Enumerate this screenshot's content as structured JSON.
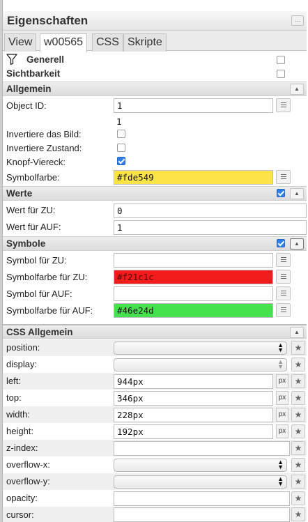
{
  "panel": {
    "title": "Eigenschaften",
    "menu_glyph": "…"
  },
  "tabs": [
    "View",
    "w00565",
    "CSS",
    "Skripte"
  ],
  "filter": {
    "generell": "Generell",
    "sichtbarkeit": "Sichtbarkeit"
  },
  "allgemein": {
    "title": "Allgemein",
    "object_id_label": "Object ID:",
    "object_id_value": "1",
    "object_id_text": "1",
    "invert_image_label": "Invertiere das Bild:",
    "invert_state_label": "Invertiere Zustand:",
    "button_square_label": "Knopf-Viereck:",
    "symbol_color_label": "Symbolfarbe:",
    "symbol_color_value": "#fde549"
  },
  "werte": {
    "title": "Werte",
    "zu_label": "Wert für ZU:",
    "zu_value": "0",
    "auf_label": "Wert für AUF:",
    "auf_value": "1"
  },
  "symbole": {
    "title": "Symbole",
    "symbol_zu_label": "Symbol für ZU:",
    "symbol_zu_value": "",
    "color_zu_label": "Symbolfarbe für ZU:",
    "color_zu_value": "#f21c1c",
    "symbol_auf_label": "Symbol für AUF:",
    "symbol_auf_value": "",
    "color_auf_label": "Symbolfarbe für AUF:",
    "color_auf_value": "#46e24d"
  },
  "css": {
    "title": "CSS Allgemein",
    "position_label": "position:",
    "display_label": "display:",
    "left_label": "left:",
    "left_value": "944px",
    "top_label": "top:",
    "top_value": "346px",
    "width_label": "width:",
    "width_value": "228px",
    "height_label": "height:",
    "height_value": "192px",
    "zindex_label": "z-index:",
    "overflowx_label": "overflow-x:",
    "overflowy_label": "overflow-y:",
    "opacity_label": "opacity:",
    "cursor_label": "cursor:",
    "px_unit": "px"
  },
  "colors": {
    "yellow": "#fde549",
    "red": "#f21c1c",
    "green": "#46e24d",
    "checkbox_blue": "#2f7fe6"
  }
}
